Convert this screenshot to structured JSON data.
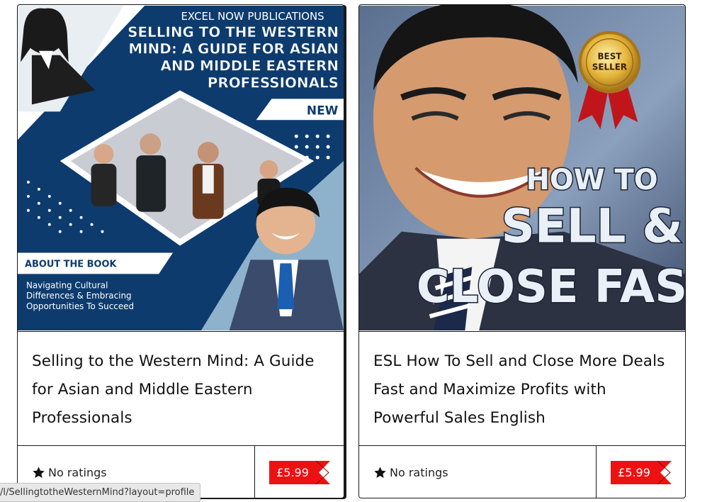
{
  "cards": [
    {
      "cover": {
        "publisher": "EXCEL NOW PUBLICATIONS",
        "title_lines": [
          "SELLING TO THE WESTERN",
          "MIND: A GUIDE FOR ASIAN",
          "AND MIDDLE EASTERN",
          "PROFESSIONALS"
        ],
        "badge": "NEW",
        "about_heading": "ABOUT THE BOOK",
        "about_lines": [
          "Navigating Cultural",
          "Differences & Embracing",
          "Opportunities To Succeed"
        ],
        "colors": {
          "navy": "#0d3b6e",
          "accent": "#ffffff"
        }
      },
      "title": "Selling to the Western Mind: A Guide for Asian and Middle Eastern Professionals",
      "rating_text": "No ratings",
      "price": "£5.99"
    },
    {
      "cover": {
        "seal_lines": [
          "BEST",
          "SELLER"
        ],
        "headline_lines": [
          "HOW TO",
          "SELL &",
          "CLOSE FAST"
        ],
        "colors": {
          "seal_gold": "#d9a72a",
          "ribbon": "#c0161b"
        }
      },
      "title": "ESL How To Sell and Close More Deals Fast and Maximize Profits with Powerful Sales English",
      "rating_text": "No ratings",
      "price": "£5.99"
    }
  ],
  "price_tag_color": "#ee1111",
  "status_url": "/l/SellingtotheWesternMind?layout=profile"
}
